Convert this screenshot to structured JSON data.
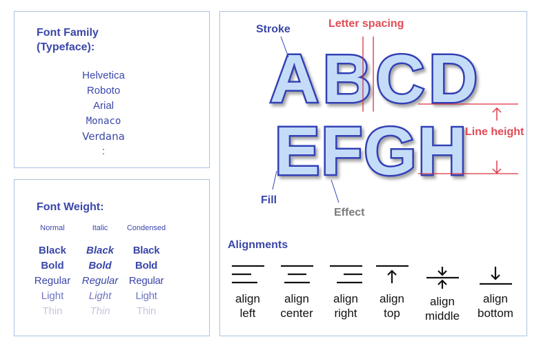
{
  "font_family": {
    "heading": "Font Family (Typeface):",
    "fonts": [
      "Helvetica",
      "Roboto",
      "Arial",
      "Monaco",
      "Verdana",
      ":"
    ]
  },
  "font_weight": {
    "heading": "Font Weight:",
    "columns": [
      {
        "header": "Normal",
        "weights": [
          "Black",
          "Bold",
          "Regular",
          "Light",
          "Thin"
        ]
      },
      {
        "header": "Italic",
        "weights": [
          "Black",
          "Bold",
          "Regular",
          "Light",
          "Thin"
        ]
      },
      {
        "header": "Condensed",
        "weights": [
          "Black",
          "Bold",
          "Regular",
          "Light",
          "Thin"
        ]
      }
    ]
  },
  "anatomy": {
    "line1": "ABCD",
    "line2": "EFGH",
    "labels": {
      "stroke": "Stroke",
      "letter_spacing": "Letter spacing",
      "line_height": "Line height",
      "fill": "Fill",
      "effect": "Effect"
    },
    "colors": {
      "fill": "#c5dcf8",
      "stroke": "#3341b5",
      "guide": "#d9303d",
      "heading": "#3a46a8",
      "effect_label": "#7a7a7a"
    }
  },
  "alignments": {
    "heading": "Alignments",
    "items": [
      {
        "icon": "align-left-icon",
        "label_line1": "align",
        "label_line2": "left"
      },
      {
        "icon": "align-center-icon",
        "label_line1": "align",
        "label_line2": "center"
      },
      {
        "icon": "align-right-icon",
        "label_line1": "align",
        "label_line2": "right"
      },
      {
        "icon": "align-top-icon",
        "label_line1": "align",
        "label_line2": "top"
      },
      {
        "icon": "align-middle-icon",
        "label_line1": "align",
        "label_line2": "middle"
      },
      {
        "icon": "align-bottom-icon",
        "label_line1": "align",
        "label_line2": "bottom"
      }
    ]
  }
}
